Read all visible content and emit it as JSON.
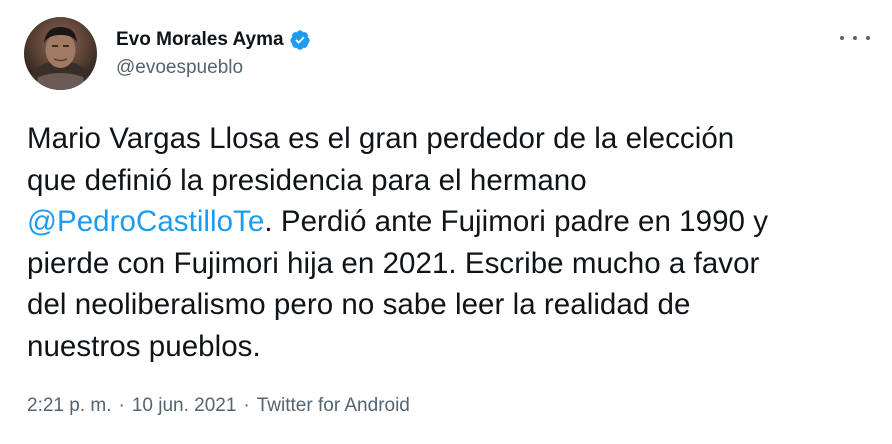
{
  "author": {
    "name": "Evo Morales Ayma",
    "handle": "@evoespueblo",
    "verified": true,
    "avatar_icon": "profile-photo"
  },
  "more_icon": "more-horizontal-icon",
  "tweet": {
    "text_line1": "Mario Vargas Llosa es el gran perdedor de la elección",
    "text_line2": "que definió la presidencia para el hermano",
    "mention": "@PedroCastilloTe",
    "text_line3_rest": ". Perdió ante Fujimori padre en 1990 y",
    "text_line4": "pierde con Fujimori hija en 2021. Escribe mucho a favor",
    "text_line5": "del neoliberalismo pero no sabe leer la realidad de",
    "text_line6": "nuestros pueblos."
  },
  "meta": {
    "time": "2:21 p. m.",
    "separator": "·",
    "date": "10 jun. 2021",
    "source": "Twitter for Android"
  },
  "colors": {
    "link": "#1d9bf0",
    "secondary_text": "#536471",
    "primary_text": "#0f1419"
  }
}
